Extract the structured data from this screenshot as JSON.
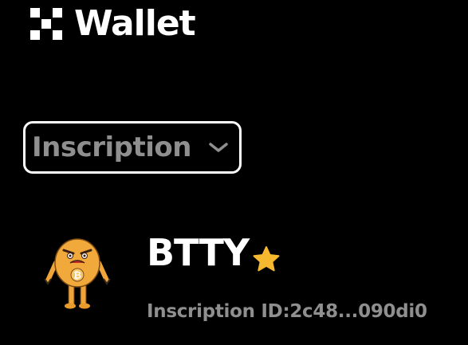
{
  "header": {
    "app_name": "Wallet",
    "logo_icon": "okx-logo-icon"
  },
  "filter": {
    "selected": "Inscription",
    "icon": "chevron-down-icon"
  },
  "asset": {
    "name": "BTTY",
    "id_label": "Inscription ID:2c48...090di0",
    "badge_icon": "star-icon",
    "avatar_icon": "bitcoin-mascot-avatar"
  },
  "colors": {
    "background": "#000000",
    "text_primary": "#ffffff",
    "text_secondary": "#8f8f8f",
    "star": "#f5b82e",
    "mascot_orange": "#f0a53a"
  }
}
